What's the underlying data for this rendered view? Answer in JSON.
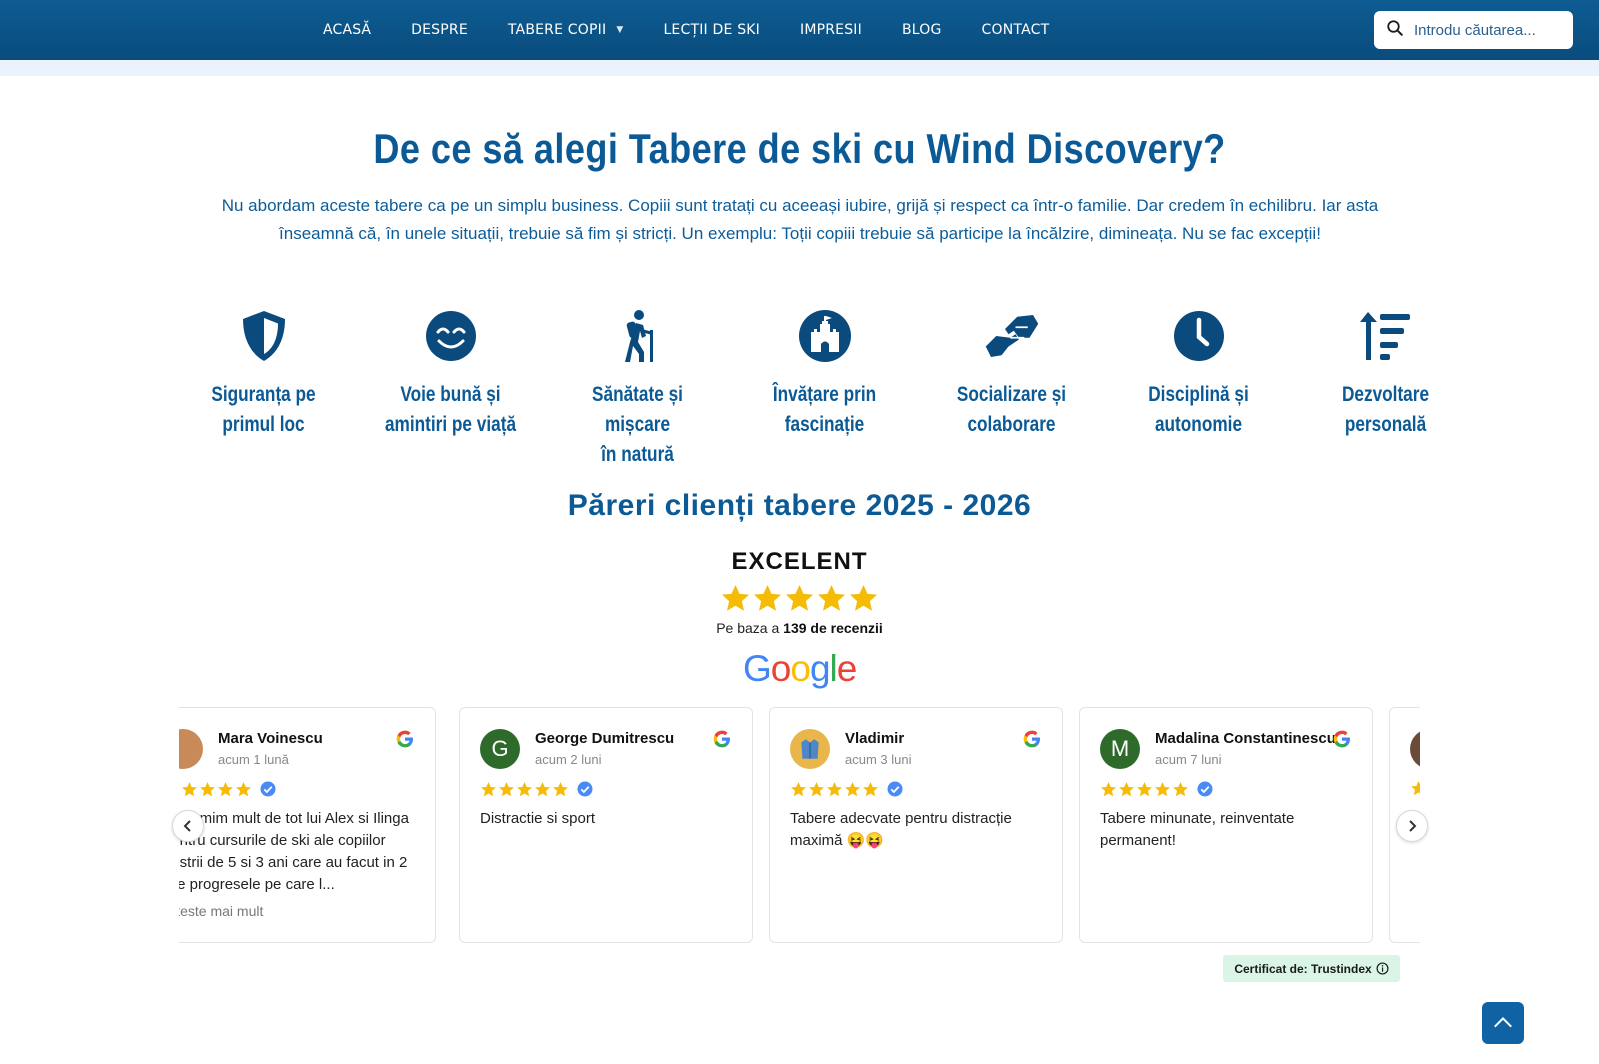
{
  "nav": {
    "items": [
      {
        "label": "ACASĂ"
      },
      {
        "label": "DESPRE"
      },
      {
        "label": "TABERE COPII",
        "has_dropdown": true
      },
      {
        "label": "LECȚII DE SKI"
      },
      {
        "label": "IMPRESII"
      },
      {
        "label": "BLOG"
      },
      {
        "label": "CONTACT"
      }
    ],
    "search_placeholder": "Introdu căutarea..."
  },
  "hero": {
    "title": "De ce să alegi Tabere de ski cu Wind Discovery?",
    "intro": "Nu abordam aceste tabere ca pe un simplu business. Copiii sunt tratați cu aceeași iubire, grijă și respect ca într-o familie. Dar credem în echilibru. Iar asta înseamnă că, în unele situații, trebuie să fim și stricți. Un exemplu: Toții copiii trebuie să participe la încălzire, dimineața. Nu se fac excepții!"
  },
  "features": [
    {
      "label": "Siguranța pe\nprimul loc",
      "icon": "shield-icon"
    },
    {
      "label": "Voie bună și\namintiri pe viață",
      "icon": "smile-icon"
    },
    {
      "label": "Sănătate și mișcare\nîn natură",
      "icon": "hiker-icon"
    },
    {
      "label": "Învățare prin\nfascinație",
      "icon": "castle-icon"
    },
    {
      "label": "Socializare și\ncolaborare",
      "icon": "handshake-icon"
    },
    {
      "label": "Disciplină și\nautonomie",
      "icon": "clock-icon"
    },
    {
      "label": "Dezvoltare\npersonală",
      "icon": "sort-up-icon"
    }
  ],
  "reviews_section": {
    "title": "Păreri clienți tabere 2025 - 2026",
    "rating_word": "EXCELENT",
    "stars": 5,
    "based_prefix": "Pe baza a ",
    "based_count": "139 de recenzii",
    "certified": "Certificat de: Trustindex"
  },
  "reviews": [
    {
      "name": "Mara Voinescu",
      "when": "acum 1 lună",
      "text": "Multumim mult de tot lui Alex si Ilinga pentru cursurile de ski ale copiilor nostrii de 5 si 3 ani care au facut in 2 zile progresele pe care l...",
      "more": "Citeste mai mult",
      "initial": "",
      "avatar_color": "#c98a5a"
    },
    {
      "name": "George Dumitrescu",
      "when": "acum 2 luni",
      "text": "Distractie si sport",
      "more": "",
      "initial": "G",
      "avatar_color": "#2e6b2a"
    },
    {
      "name": "Vladimir",
      "when": "acum 3 luni",
      "text": "Tabere adecvate pentru distracție maximă 😝😝",
      "more": "",
      "initial": "",
      "avatar_color": "#e8b64a"
    },
    {
      "name": "Madalina Constantinescu",
      "when": "acum 7 luni",
      "text": "Tabere minunate, reinventate permanent!",
      "more": "",
      "initial": "M",
      "avatar_color": "#2e6b2a"
    }
  ],
  "colors": {
    "nav_bg": "#0a4c7d",
    "brand_blue": "#0b5a96",
    "star": "#f6bb06",
    "verified": "#4a8af4",
    "cert_bg": "#daf5e6"
  }
}
